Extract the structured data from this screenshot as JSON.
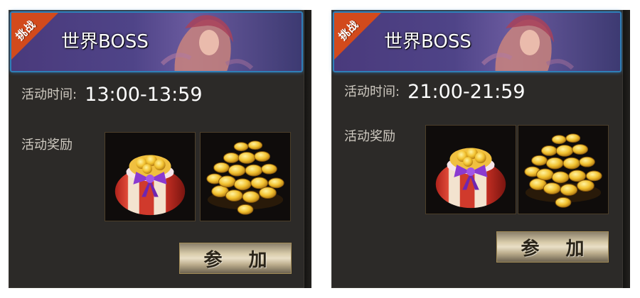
{
  "cards": [
    {
      "badge": "挑战",
      "title": "世界BOSS",
      "time_label": "活动时间:",
      "time_value": "13:00-13:59",
      "reward_label": "活动奖励",
      "rewards": [
        "gift-bag-icon",
        "gold-coins-icon"
      ],
      "join_label": "参 加"
    },
    {
      "badge": "挑战",
      "title": "世界BOSS",
      "time_label": "活动时间:",
      "time_value": "21:00-21:59",
      "reward_label": "活动奖励",
      "rewards": [
        "gift-bag-icon",
        "gold-coins-icon"
      ],
      "join_label": "参 加"
    }
  ],
  "colors": {
    "panel_bg": "#2c2a28",
    "header_border": "#2f7fb8",
    "ribbon": "#d24a1c",
    "gold": "#f2c230"
  }
}
